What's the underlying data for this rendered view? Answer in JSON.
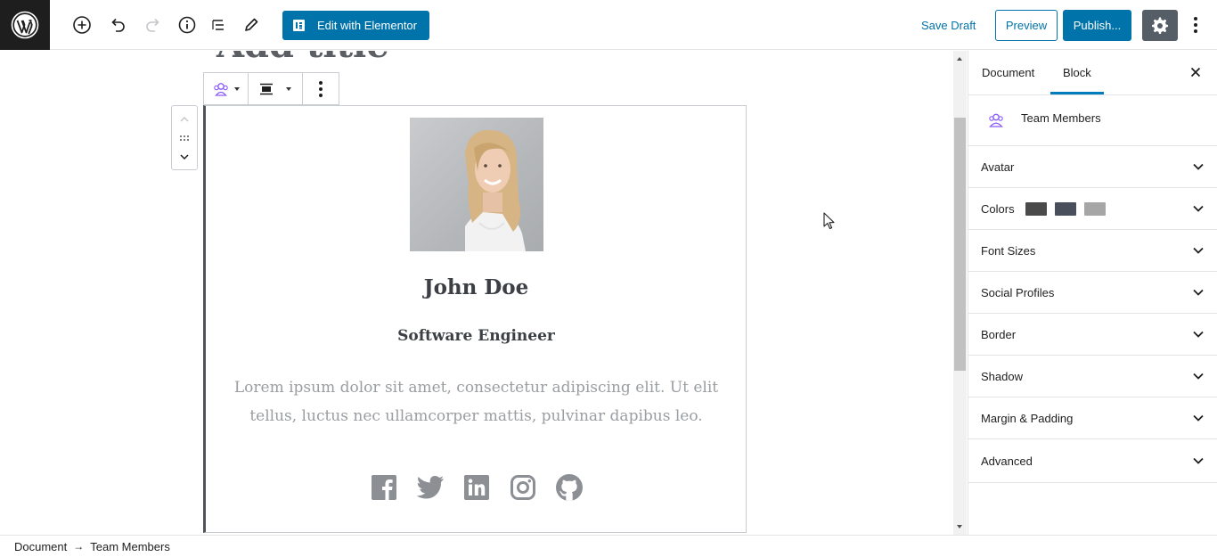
{
  "toolbar": {
    "elementor_label": "Edit with Elementor",
    "save_draft_label": "Save Draft",
    "preview_label": "Preview",
    "publish_label": "Publish..."
  },
  "editor": {
    "title": "Add title",
    "member": {
      "name": "John Doe",
      "role": "Software Engineer",
      "bio": "Lorem ipsum dolor sit amet, consectetur adipiscing elit. Ut elit tellus, luctus nec ullamcorper mattis, pulvinar dapibus leo.",
      "socials": [
        "facebook-icon",
        "twitter-icon",
        "linkedin-icon",
        "instagram-icon",
        "github-icon"
      ]
    }
  },
  "sidebar": {
    "tabs": [
      {
        "label": "Document",
        "active": false
      },
      {
        "label": "Block",
        "active": true
      }
    ],
    "block_name": "Team Members",
    "panels": [
      {
        "label": "Avatar"
      },
      {
        "label": "Colors"
      },
      {
        "label": "Font Sizes"
      },
      {
        "label": "Social Profiles"
      },
      {
        "label": "Border"
      },
      {
        "label": "Shadow"
      },
      {
        "label": "Margin & Padding"
      },
      {
        "label": "Advanced"
      }
    ],
    "color_swatches": [
      "#4a4a4a",
      "#4a4f5c",
      "#a6a6a6"
    ]
  },
  "breadcrumb": {
    "root": "Document",
    "separator": "→",
    "current": "Team Members"
  },
  "colors": {
    "accent": "#0073aa",
    "settings_bg": "#555d66",
    "dark": "#1e1e1e"
  }
}
